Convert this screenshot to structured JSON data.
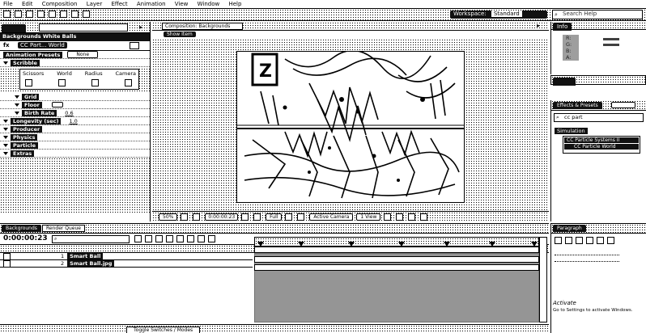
{
  "menu": [
    "File",
    "Edit",
    "Composition",
    "Layer",
    "Effect",
    "Animation",
    "View",
    "Window",
    "Help"
  ],
  "workspace": {
    "label": "Workspace:",
    "value": "Standard"
  },
  "search_help": {
    "placeholder": "Search Help"
  },
  "effect_controls": {
    "breadcrumb": "Backgrounds White Balls",
    "layer_label": "CC Part... World",
    "rows": [
      {
        "name": "Animation Presets",
        "value": "None"
      },
      {
        "name": "Scribble",
        "value": ""
      },
      {
        "name": "Grid",
        "value": ""
      },
      {
        "name": "Floor",
        "value": ""
      },
      {
        "name": "Birth Rate",
        "value": "0.6"
      },
      {
        "name": "Longevity (sec)",
        "value": "1.0"
      },
      {
        "name": "Producer",
        "value": ""
      },
      {
        "name": "Physics",
        "value": ""
      },
      {
        "name": "Particle",
        "value": ""
      },
      {
        "name": "Extras",
        "value": ""
      }
    ],
    "tool_labels": [
      "Scissors",
      "World",
      "Radius",
      "Camera"
    ]
  },
  "composition": {
    "tab": "Composition: Backgrounds",
    "show_button": "Show Item",
    "zoom": "50%",
    "time": "0:00:00:23",
    "resolution": "Full",
    "view": "Active Camera",
    "layout": "1 View"
  },
  "info_panel": {
    "tab": "Info",
    "lines": [
      "R:",
      "G:",
      "B:",
      "A:"
    ]
  },
  "effects_presets": {
    "tab": "Effects & Presets",
    "search_value": "cc part",
    "category": "Simulation",
    "items": [
      "CC Particle Systems II",
      "CC Particle World"
    ]
  },
  "timeline": {
    "tab": "Backgrounds",
    "render_tab": "Render Queue",
    "timecode": "0:00:00:23",
    "search_placeholder": "",
    "layers": [
      {
        "num": "1",
        "name": "Smart Ball"
      },
      {
        "num": "2",
        "name": "Smart Ball.jpg"
      }
    ],
    "footer": "Toggle Switches / Modes"
  },
  "paragraph_panel": {
    "tab": "Paragraph"
  },
  "activation": {
    "title": "Activate",
    "subtitle": "Go to Settings to activate Windows."
  }
}
